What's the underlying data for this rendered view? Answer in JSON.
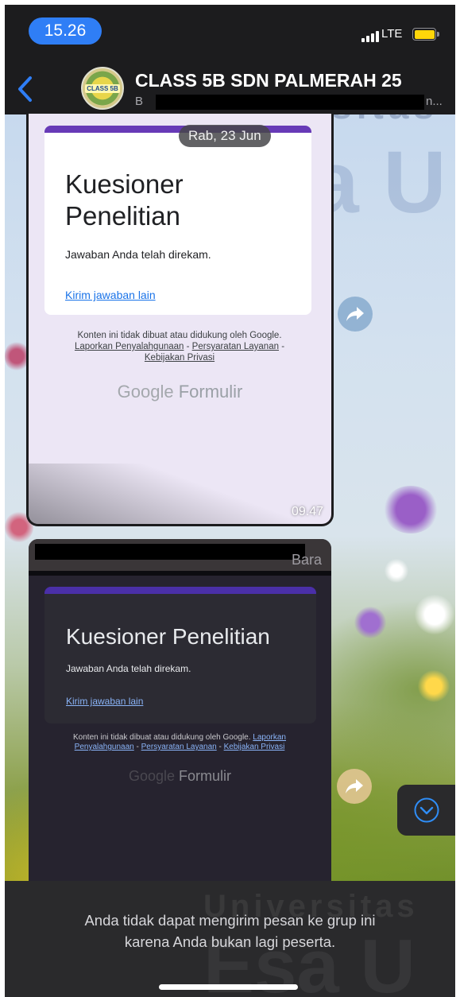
{
  "status_bar": {
    "time": "15.26",
    "network": "LTE"
  },
  "header": {
    "group_name": "CLASS 5B SDN PALMERAH 25",
    "subtitle_prefix": "B",
    "subtitle_suffix": "n...",
    "avatar_text": "CLASS 5B"
  },
  "date_chip": "Rab, 23 Jun",
  "message_1": {
    "form_title": "Kuesioner Penelitian",
    "form_message": "Jawaban Anda telah direkam.",
    "form_link": "Kirim jawaban lain",
    "disclaimer_lead": "Konten ini tidak dibuat atau didukung oleh Google.",
    "report_link": "Laporkan Penyalahgunaan",
    "terms_link": "Persyaratan Layanan",
    "privacy_link": "Kebijakan Privasi",
    "brand_google": "Google",
    "brand_product": "Formulir",
    "time": "09.47"
  },
  "message_2": {
    "sender_tail": "Bara",
    "form_title": "Kuesioner Penelitian",
    "form_message": "Jawaban Anda telah direkam.",
    "form_link": "Kirim jawaban lain",
    "disclaimer_lead": "Konten ini tidak dibuat atau didukung oleh Google.",
    "report_link": "Laporkan Penyalahgunaan",
    "terms_link": "Persyaratan Layanan",
    "privacy_link": "Kebijakan Privasi",
    "brand_google": "Google",
    "brand_product": "Formulir"
  },
  "footer": {
    "notice_line_1": "Anda tidak dapat mengirim pesan ke grup ini",
    "notice_line_2": "karena Anda bukan lagi peserta."
  },
  "watermark": {
    "word_1": "Universitas",
    "word_2": "Esa U"
  },
  "colors": {
    "accent_blue": "#2f7ef6",
    "form_purple": "#673ab7",
    "sender_orange": "#e6902b",
    "battery_yellow": "#ffd60a"
  },
  "icons": [
    "back-chevron-icon",
    "signal-icon",
    "battery-icon",
    "forward-icon",
    "chevron-down-circle-icon"
  ]
}
